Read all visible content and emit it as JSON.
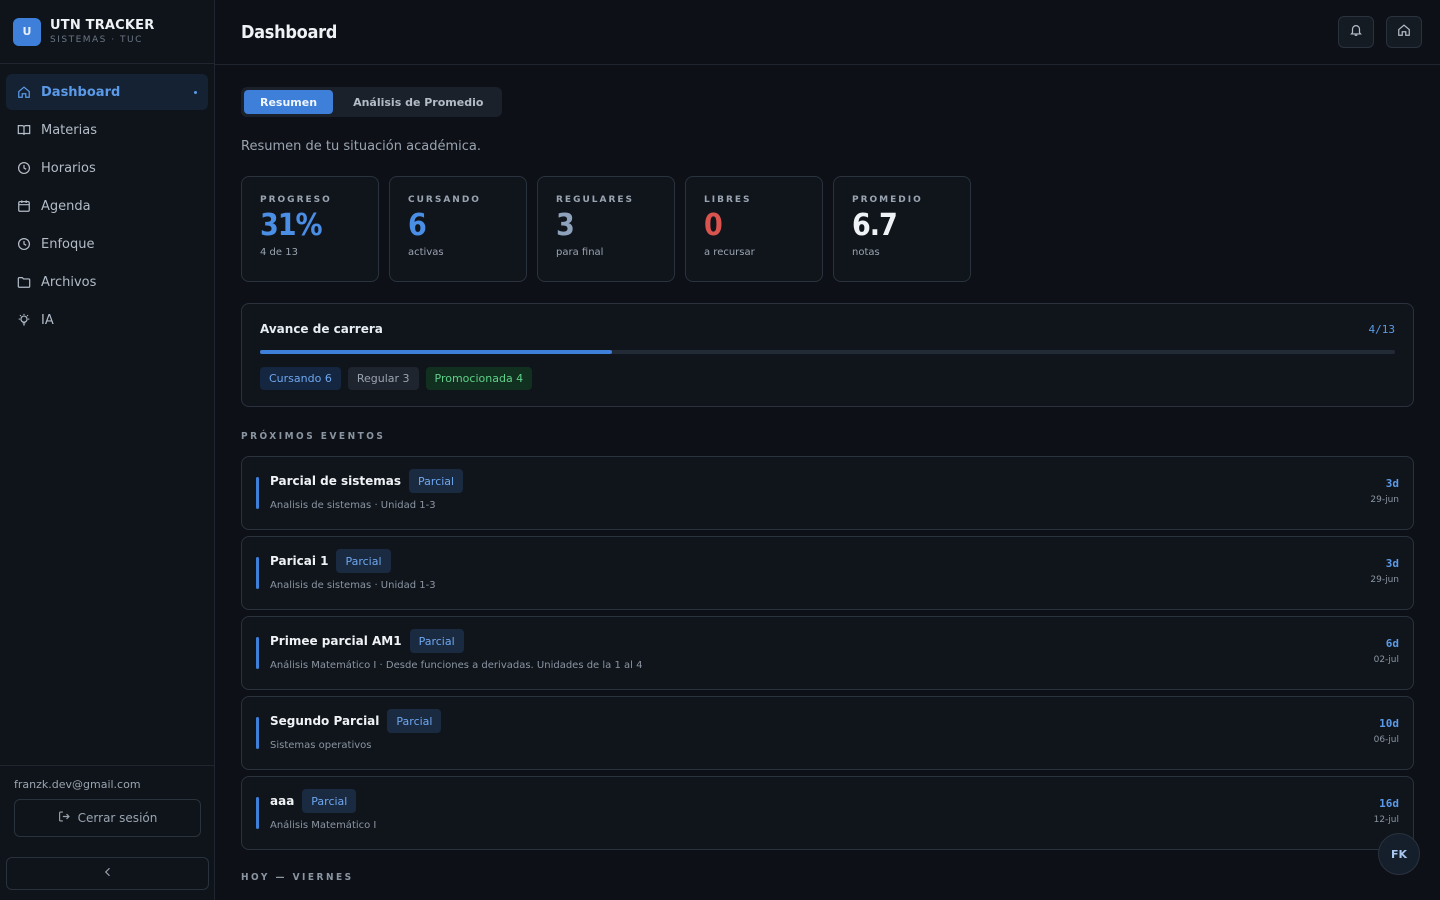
{
  "brand": {
    "logo_letter": "U",
    "title": "UTN TRACKER",
    "subtitle": "SISTEMAS · TUC"
  },
  "sidebar": {
    "items": [
      {
        "label": "Dashboard",
        "icon": "home-icon",
        "active": true
      },
      {
        "label": "Materias",
        "icon": "book-icon"
      },
      {
        "label": "Horarios",
        "icon": "clock-icon"
      },
      {
        "label": "Agenda",
        "icon": "calendar-icon"
      },
      {
        "label": "Enfoque",
        "icon": "clock-icon"
      },
      {
        "label": "Archivos",
        "icon": "folder-icon"
      },
      {
        "label": "IA",
        "icon": "lightbulb-icon"
      }
    ],
    "user_email": "franzk.dev@gmail.com",
    "logout_label": "Cerrar sesión"
  },
  "header": {
    "title": "Dashboard"
  },
  "tabs": [
    {
      "label": "Resumen",
      "active": true
    },
    {
      "label": "Análisis de Promedio",
      "active": false
    }
  ],
  "intro": "Resumen de tu situación académica.",
  "stats": [
    {
      "label": "PROGRESO",
      "value": "31%",
      "sub": "4 de 13",
      "color": "#4b8ee6"
    },
    {
      "label": "CURSANDO",
      "value": "6",
      "sub": "activas",
      "color": "#4b8ee6"
    },
    {
      "label": "REGULARES",
      "value": "3",
      "sub": "para final",
      "color": "#8fa2bb"
    },
    {
      "label": "LIBRES",
      "value": "0",
      "sub": "a recursar",
      "color": "#d9534f"
    },
    {
      "label": "PROMEDIO",
      "value": "6.7",
      "sub": "notas",
      "color": "#f0f3f6"
    }
  ],
  "progress": {
    "title": "Avance de carrera",
    "count": "4/13",
    "fraction": 0.31,
    "chips": [
      {
        "label": "Cursando 6",
        "bg": "#152640",
        "fg": "#6ea7ef"
      },
      {
        "label": "Regular 3",
        "bg": "#1e252f",
        "fg": "#9aa4b0"
      },
      {
        "label": "Promocionada 4",
        "bg": "#12301f",
        "fg": "#5fd08a"
      }
    ]
  },
  "upcoming_label": "PRÓXIMOS EVENTOS",
  "events": [
    {
      "title": "Parcial de sistemas",
      "tag": "Parcial",
      "desc": "Analisis de sistemas · Unidad 1-3",
      "days": "3d",
      "date": "29-jun"
    },
    {
      "title": "Paricai 1",
      "tag": "Parcial",
      "desc": "Analisis de sistemas · Unidad 1-3",
      "days": "3d",
      "date": "29-jun"
    },
    {
      "title": "Primee parcial AM1",
      "tag": "Parcial",
      "desc": "Análisis Matemático I · Desde funciones a derivadas. Unidades de la 1 al 4",
      "days": "6d",
      "date": "02-jul"
    },
    {
      "title": "Segundo Parcial",
      "tag": "Parcial",
      "desc": "Sistemas operativos",
      "days": "10d",
      "date": "06-jul"
    },
    {
      "title": "aaa",
      "tag": "Parcial",
      "desc": "Análisis Matemático I",
      "days": "16d",
      "date": "12-jul"
    }
  ],
  "today_label": "HOY — VIERNES",
  "avatar_initials": "FK"
}
